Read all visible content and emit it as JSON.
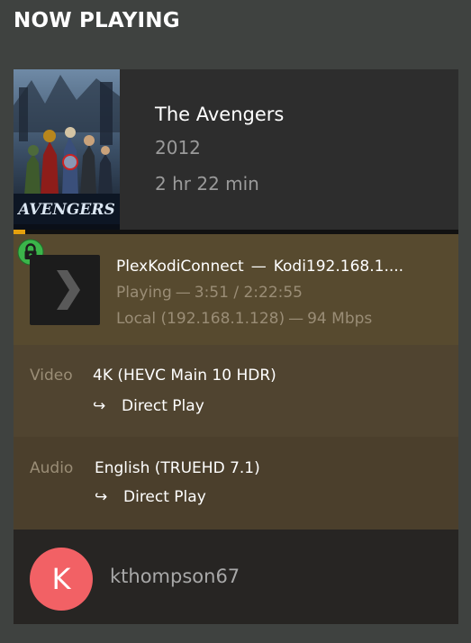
{
  "page": {
    "title": "NOW PLAYING"
  },
  "media": {
    "poster_text": "AVENGERS",
    "title": "The Avengers",
    "year": "2012",
    "duration": "2 hr 22 min",
    "progress_fraction": 0.027
  },
  "session": {
    "secure": true,
    "product": "PlexKodiConnect",
    "separator": "—",
    "device": "Kodi192.168.1....",
    "state": "Playing",
    "position": "3:51 / 2:22:55",
    "location": "Local (192.168.1.128)",
    "bandwidth": "94 Mbps"
  },
  "streams": {
    "video": {
      "label": "Video",
      "format": "4K (HEVC Main 10 HDR)",
      "decision": "Direct Play"
    },
    "audio": {
      "label": "Audio",
      "format": "English (TRUEHD 7.1)",
      "decision": "Direct Play"
    },
    "arrow_glyph": "↪"
  },
  "user": {
    "avatar_initial": "K",
    "username": "kthompson67"
  },
  "icons": {
    "lock": "lock-icon",
    "player": "chevron-right-icon",
    "arrow": "redirect-arrow-icon"
  },
  "colors": {
    "accent": "#e5a00d",
    "secure": "#3bb54a",
    "avatar": "#f26165"
  }
}
